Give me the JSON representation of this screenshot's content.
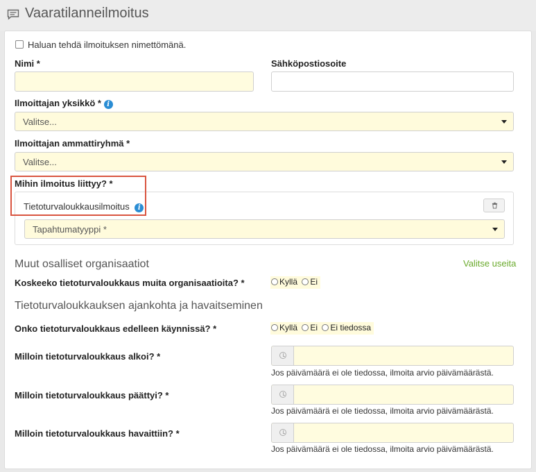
{
  "window": {
    "title": "Vaaratilanneilmoitus",
    "icon": "comment-icon"
  },
  "form": {
    "anonymous_label": "Haluan tehdä ilmoituksen nimettömänä.",
    "name_label": "Nimi *",
    "email_label": "Sähköpostiosoite",
    "unit_label": "Ilmoittajan yksikkö *",
    "unit_value": "Valitse...",
    "profession_label": "Ilmoittajan ammattiryhmä *",
    "profession_value": "Valitse...",
    "relates_label": "Mihin ilmoitus liittyy? *",
    "report_type": "Tietoturvaloukkausilmoitus",
    "event_type_value": "Tapahtumatyyppi *"
  },
  "orgs": {
    "title": "Muut osalliset organisaatiot",
    "select_many_link": "Valitse useita",
    "question": "Koskeeko tietoturvaloukkaus muita organisaatioita? *",
    "options": [
      "Kyllä",
      "Ei"
    ]
  },
  "timing": {
    "title": "Tietoturvaloukkauksen ajankohta ja havaitseminen",
    "ongoing_question": "Onko tietoturvaloukkaus edelleen käynnissä? *",
    "ongoing_options": [
      "Kyllä",
      "Ei",
      "Ei tiedossa"
    ],
    "start_label": "Milloin tietoturvaloukkaus alkoi? *",
    "end_label": "Milloin tietoturvaloukkaus päättyi? *",
    "detected_label": "Milloin tietoturvaloukkaus havaittiin? *",
    "date_help": "Jos päivämäärä ei ole tiedossa, ilmoita arvio päivämäärästä."
  },
  "colors": {
    "required_field_bg": "#fffcdf",
    "highlight_border": "#d9543f",
    "info_icon": "#2a8dd4",
    "link": "#6aaa2c"
  }
}
